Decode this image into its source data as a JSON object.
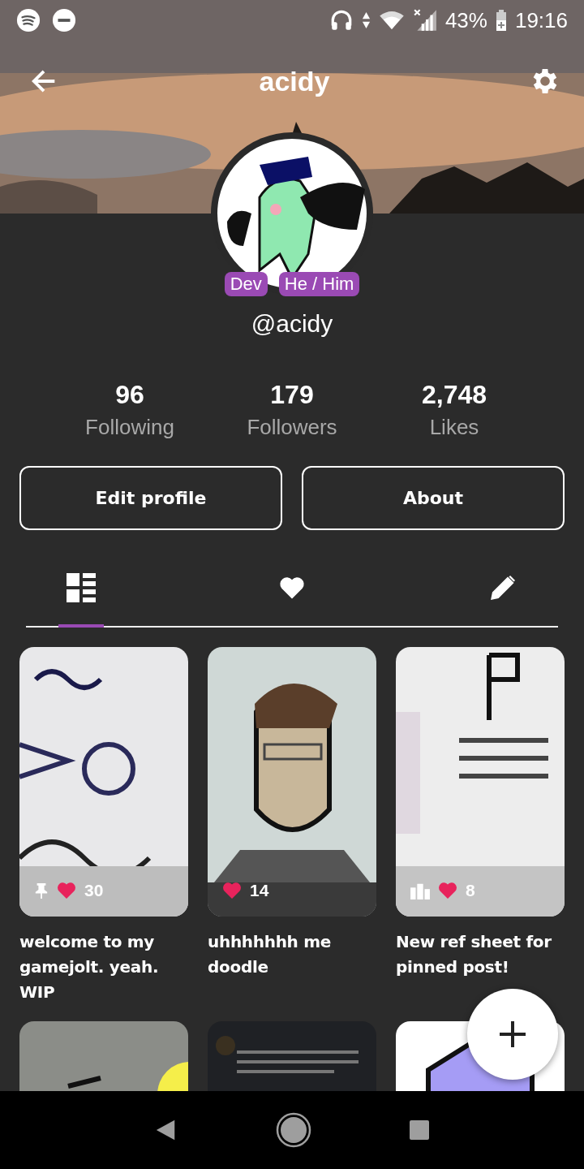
{
  "status_bar": {
    "battery": "43%",
    "time": "19:16"
  },
  "header": {
    "title": "acidy"
  },
  "profile": {
    "badges": [
      "Dev",
      "He / Him"
    ],
    "handle": "@acidy"
  },
  "stats": [
    {
      "value": "96",
      "label": "Following"
    },
    {
      "value": "179",
      "label": "Followers"
    },
    {
      "value": "2,748",
      "label": "Likes"
    }
  ],
  "buttons": [
    "Edit profile",
    "About"
  ],
  "tabs": [
    {
      "kind": "posts",
      "selected": true
    },
    {
      "kind": "likes",
      "selected": false
    },
    {
      "kind": "edit",
      "selected": false
    }
  ],
  "posts": [
    {
      "pinned": true,
      "podium": false,
      "likes": "30",
      "caption": "welcome to my gamejolt. yeah. WIP"
    },
    {
      "pinned": false,
      "podium": false,
      "likes": "14",
      "caption": "uhhhhhhh me doodle"
    },
    {
      "pinned": false,
      "podium": true,
      "likes": "8",
      "caption": "New ref sheet for pinned post!"
    }
  ],
  "more_posts": [
    {
      "kind": "picture"
    },
    {
      "kind": "picture"
    },
    {
      "kind": "picture"
    }
  ]
}
